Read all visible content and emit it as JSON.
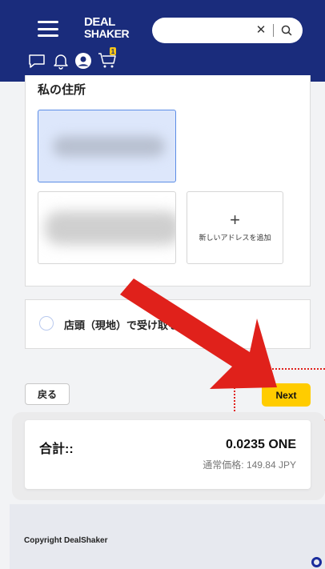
{
  "header": {
    "logo_line1": "DEAL",
    "logo_line2": "SHAKER",
    "search": {
      "value": "",
      "placeholder": "",
      "clear_symbol": "✕"
    },
    "icons": [
      "menu-icon",
      "message-icon",
      "bell-icon",
      "user-icon",
      "cart-icon"
    ],
    "cart_count": "1"
  },
  "address": {
    "title": "私の住所",
    "add_new": {
      "symbol": "+",
      "label": "新しいアドレスを追加"
    }
  },
  "pickup": {
    "label": "店頭（現地）で受け取る"
  },
  "buttons": {
    "back": "戻る",
    "next": "Next"
  },
  "total": {
    "label": "合計::",
    "value": "0.0235 ONE",
    "normal_price": "通常価格: 149.84 JPY"
  },
  "footer": {
    "copyright": "Copyright DealShaker"
  },
  "colors": {
    "header": "#1a2c7c",
    "accent": "#ffcc00",
    "annotation": "#e0211b",
    "selected_border": "#5c8de6"
  }
}
